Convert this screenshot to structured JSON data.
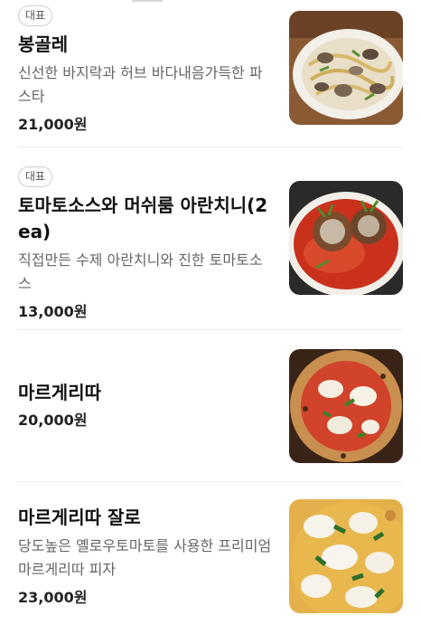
{
  "menu": {
    "items": [
      {
        "badge": "대표",
        "name": "봉골레",
        "description": "신선한 바지락과 허브 바다내음가득한 파스타",
        "price": "21,000원",
        "image": "vongole-pasta-photo"
      },
      {
        "badge": "대표",
        "name": "토마토소스와 머쉬룸 아란치니(2ea)",
        "description": "직접만든 수제 아란치니와 진한 토마토소스",
        "price": "13,000원",
        "image": "arancini-tomato-sauce-photo"
      },
      {
        "name": "마르게리따",
        "price": "20,000원",
        "image": "margherita-pizza-photo"
      },
      {
        "name": "마르게리따 잘로",
        "description": "당도높은 옐로우토마토를 사용한 프리미엄 마르게리따 피자",
        "price": "23,000원",
        "image": "margherita-giallo-pizza-photo"
      }
    ]
  }
}
